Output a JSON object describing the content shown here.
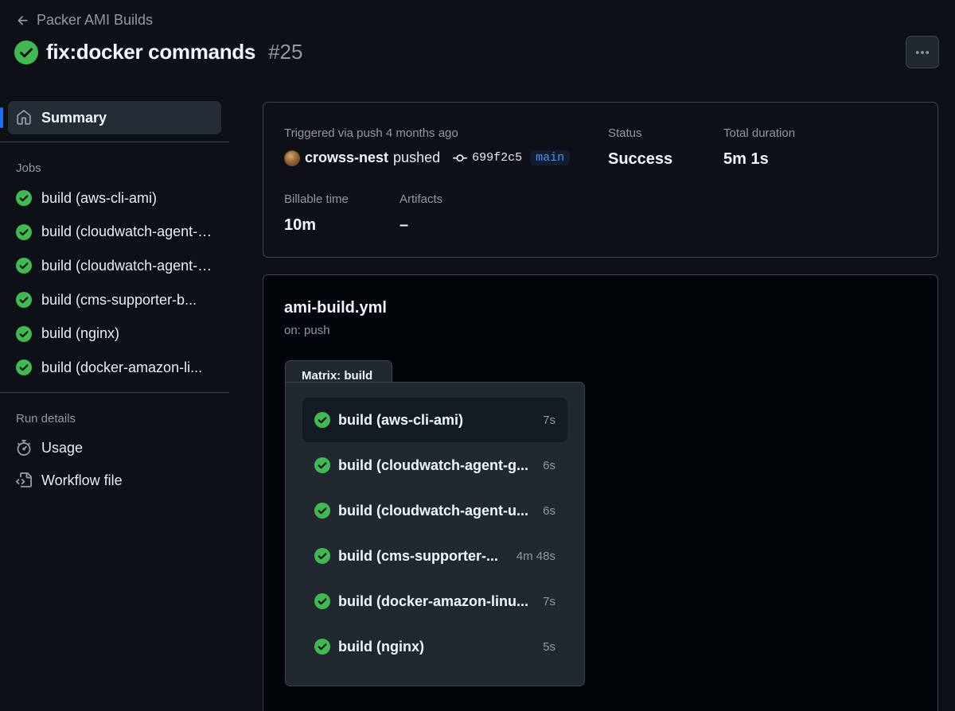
{
  "header": {
    "back_label": "Packer AMI Builds",
    "title": "fix:docker commands",
    "run_number": "#25"
  },
  "sidebar": {
    "summary_label": "Summary",
    "jobs_heading": "Jobs",
    "jobs": [
      "build (aws-cli-ami)",
      "build (cloudwatch-agent-g...",
      "build (cloudwatch-agent-u...",
      "build (cms-supporter-b...",
      "build (nginx)",
      "build (docker-amazon-li..."
    ],
    "run_details_heading": "Run details",
    "usage_label": "Usage",
    "workflow_file_label": "Workflow file"
  },
  "summary": {
    "triggered_label": "Triggered via push 4 months ago",
    "actor": "crowss-nest",
    "action": "pushed",
    "commit": "699f2c5",
    "branch": "main",
    "status_label": "Status",
    "status_value": "Success",
    "duration_label": "Total duration",
    "duration_value": "5m 1s",
    "billable_label": "Billable time",
    "billable_value": "10m",
    "artifacts_label": "Artifacts",
    "artifacts_value": "–"
  },
  "workflow": {
    "file": "ami-build.yml",
    "trigger": "on: push",
    "matrix_label": "Matrix: build",
    "jobs": [
      {
        "name": "build (aws-cli-ami)",
        "duration": "7s"
      },
      {
        "name": "build (cloudwatch-agent-g...",
        "duration": "6s"
      },
      {
        "name": "build (cloudwatch-agent-u...",
        "duration": "6s"
      },
      {
        "name": "build (cms-supporter-...",
        "duration": "4m 48s"
      },
      {
        "name": "build (docker-amazon-linu...",
        "duration": "7s"
      },
      {
        "name": "build (nginx)",
        "duration": "5s"
      }
    ]
  },
  "colors": {
    "success": "#3fb950",
    "accent": "#1f6feb",
    "link": "#4493f8"
  }
}
